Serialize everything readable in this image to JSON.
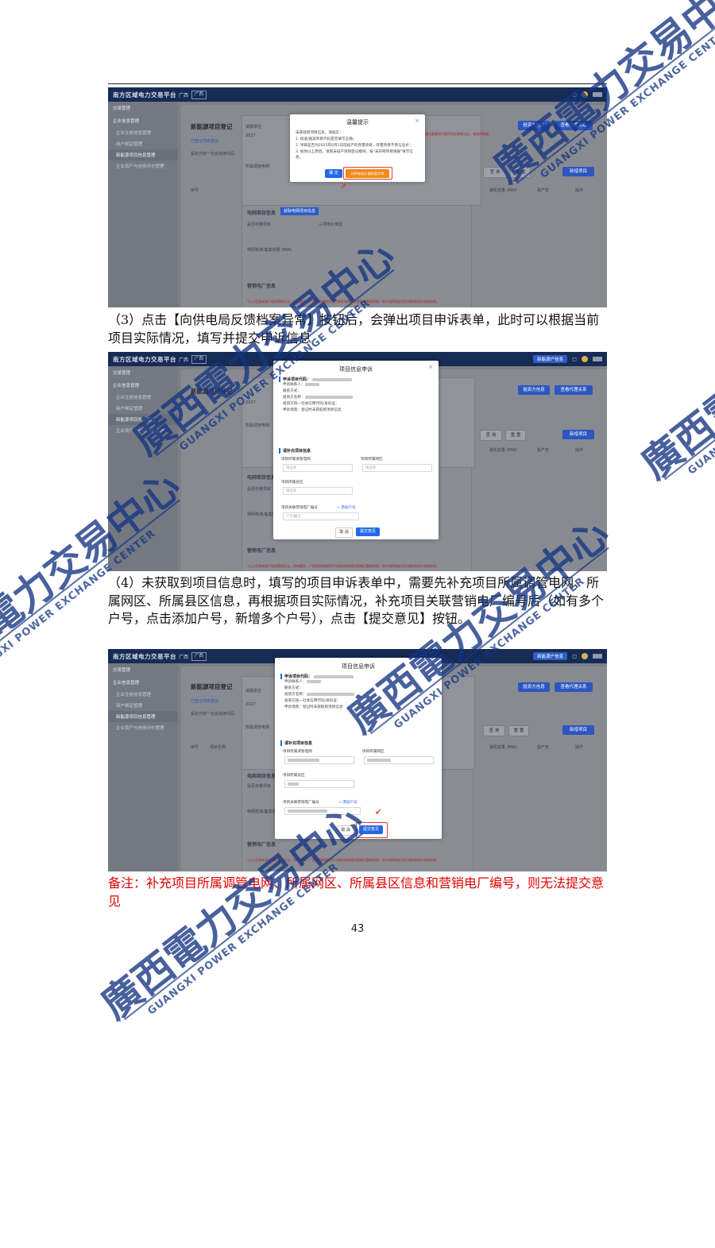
{
  "screenshot_common": {
    "platform_name": "南方区域电力交易平台",
    "region": "广西",
    "sidebar": [
      "交易管理",
      "企业信息管理",
      "企业注册信息管理",
      "用户绑定管理",
      "新能源项目信息管理",
      "企业资产与信用评价管理"
    ],
    "page_title": "新能源项目登记",
    "top_right_button": "新能源户信息",
    "button_supplier_info": "投资方信息",
    "button_agent_relation": "查看代理关系",
    "button_query": "查 询",
    "button_reset": "重 置",
    "button_add_project": "新增项目",
    "tab_registered": "已登记项目登记",
    "label_report_unit": "填报单位",
    "value_year": "2027",
    "label_grid": "所属调管电网",
    "label_investor_credit": "投资方统一社会信用代码",
    "col_seq": "序号",
    "col_project_name": "项目名称",
    "col_capacity": "装机容量 (MW)",
    "col_type": "投产年",
    "col_action": "操作",
    "section_grid_info": "电网项目信息",
    "button_get_grid_info": "获取电网项目信息",
    "label_existing_project": "是否存量项目",
    "label_three_phase": "三项电价类型",
    "label_capacity": "电网核准/备案容量 (MW)",
    "section_marketing": "营销电厂信息",
    "marketing_warning": "*以上信息来源于电网营销企业。如有疑异，广西电网调度项目可联系电网核实更新后重新获取；地方电网辖区项目请联系地方电网修改。",
    "warning_right": "请注意事项已填写的信息确认后，请选择数量。"
  },
  "dialog1": {
    "title": "温馨提示",
    "lead": "未获取到项目信息，请核实：",
    "items": [
      "1. 核准/备案项目代码是否填写正确；",
      "2. 项目是否为2025年6月1日前投产的存量项目，存量项目不参与竞价；",
      "3. 如你以上原因，请到未投产项目登记模块，按\"未开网项目填报\"填写信息。"
    ],
    "confirm": "确 定",
    "feedback_button": "向供电局反馈档案异常"
  },
  "appeal_dialog": {
    "title": "项目信息申诉",
    "section_applicant": "申诉项目代码：",
    "applicant_contact": "申诉联系人：",
    "contact_method": "联系方式：",
    "investor_name": "投资方名称：",
    "investor_code": "投资方统一社会信用代码/身份证：",
    "scenario": "申诉场景：登记时未获取到项目信息",
    "section_supplement": "请补充项目信息",
    "label_grid": "项目所属调管电网",
    "label_area": "项目所属网区",
    "label_county": "项目所属县区",
    "placeholder_select": "请选择",
    "label_account": "项目关联营销电厂编号",
    "add_account": "+ 添加户号",
    "placeholder_account": "户号/编号",
    "cancel": "取 消",
    "submit": "提交意见"
  },
  "paragraph_3": "（3）点击【向供电局反馈档案异常】按钮后，会弹出项目申诉表单，此时可以根据当前项目实际情况，填写并提交申诉信息",
  "paragraph_4": "（4）未获取到项目信息时，填写的项目申诉表单中，需要先补充项目所属调管电网、所属网区、所属县区信息，再根据项目实际情况，补充项目关联营销电厂编号后（如有多个户号，点击添加户号，新增多个户号），点击【提交意见】按钮。",
  "note": "备注：补充项目所属调管电网、所属网区、所属县区信息和营销电厂编号，则无法提交意见",
  "page_number": "43",
  "watermark": {
    "cn": "廣西電力交易中心",
    "en": "GUANGXI POWER EXCHANGE CENTER"
  }
}
